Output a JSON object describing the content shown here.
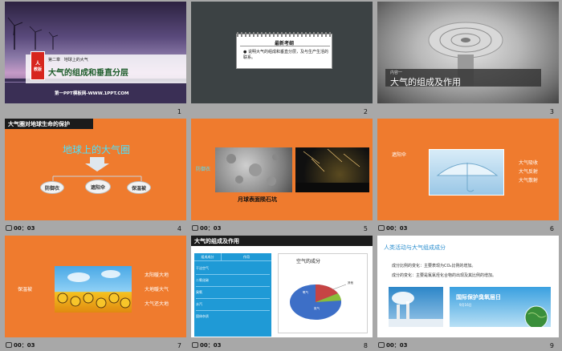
{
  "slides": [
    {
      "num": "1",
      "chapter": "第二章",
      "chapter_sub": "地球上的大气",
      "badge_top": "人",
      "badge_bot": "教版",
      "title": "大气的组成和垂直分层",
      "footer": "第一PPT模板网-WWW.1PPT.COM"
    },
    {
      "num": "2",
      "box_title": "最新考纲",
      "bullet": "说明大气的组成和垂直分层，及与生产生活的联系。"
    },
    {
      "num": "3",
      "kicker": "内容一",
      "title": "大气的组成及作用"
    },
    {
      "num": "4",
      "header": "大气圈对地球生命的保护",
      "subtitle": "地球上的大气圈",
      "pills": [
        "防御衣",
        "遮阳伞",
        "保温被"
      ],
      "timing": "00：03"
    },
    {
      "num": "5",
      "left_label": "防御衣",
      "caption": "月球表面陨石坑",
      "timing": "00：03"
    },
    {
      "num": "6",
      "left_label": "遮阳伞",
      "right_labels": [
        "大气吸收",
        "大气反射",
        "大气散射"
      ],
      "timing": "00：03"
    },
    {
      "num": "7",
      "left_label": "保温被",
      "right_labels": [
        "太阳暖大地",
        "大地暖大气",
        "大气还大地"
      ],
      "timing": "00：03"
    },
    {
      "num": "8",
      "header": "大气的组成及作用",
      "chart_title": "空气的成分",
      "table_head": [
        "组成成分",
        "作用"
      ],
      "rows": [
        "干洁空气",
        "二氧化碳",
        "臭氧",
        "水汽",
        "固体杂质"
      ],
      "pie_labels": [
        "氧气",
        "氮气",
        "其他"
      ],
      "timing": "00：03"
    },
    {
      "num": "9",
      "title": "人类活动与大气组成成分",
      "line1": "成分比例的变化：主要表现为CO₂比例的增加。",
      "line2": "成分的变化：主要是氟氯烃化合物的出现及其比例的增加。",
      "poster": "国际保护臭氧层日",
      "poster_date": "9月16日",
      "timing": "00：03"
    }
  ],
  "colors": {
    "accent": "#ef7b2e",
    "selection": "#e35b1f",
    "chapter_badge": "#d7261e"
  }
}
